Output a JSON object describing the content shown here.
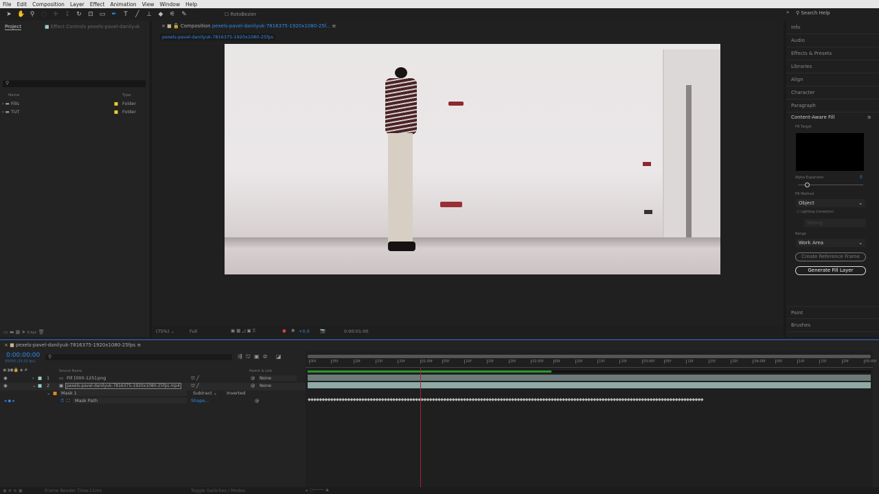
{
  "menu": [
    "File",
    "Edit",
    "Composition",
    "Layer",
    "Effect",
    "Animation",
    "View",
    "Window",
    "Help"
  ],
  "toolbar": {
    "rotobezier": "RotoBezier",
    "search_help": "Search Help"
  },
  "project": {
    "tab": "Project",
    "effect_controls_tab": "Effect Controls pexels-pavel-danilyuk",
    "columns": {
      "name": "Name",
      "type": "Type"
    },
    "items": [
      {
        "name": "Fills",
        "type": "Folder"
      },
      {
        "name": "TUT",
        "type": "Folder"
      }
    ],
    "bpc": "8 bpc"
  },
  "composition": {
    "tab_prefix": "Composition",
    "tab_name": "pexels-pavel-danilyuk-7816375-1920x1080-25f...",
    "subtab": "pexels-pavel-danilyuk-7816375-1920x1080-25fps",
    "zoom": "(75%)",
    "resolution": "Full",
    "exposure": "+0.0",
    "timecode": "0:00:01:00"
  },
  "right_panel": {
    "items": [
      "Info",
      "Audio",
      "Effects & Presets",
      "Libraries",
      "Align",
      "Character",
      "Paragraph"
    ],
    "caf": {
      "title": "Content-Aware Fill",
      "fill_target": "Fill Target",
      "alpha_expansion": "Alpha Expansion",
      "alpha_value": "5",
      "alpha_fraction": 0.1,
      "fill_method": "Fill Method",
      "fill_method_value": "Object",
      "lighting": "Lighting Correction",
      "lighting_value": "Strong",
      "range": "Range",
      "range_value": "Work Area",
      "create_ref": "Create Reference Frame",
      "generate": "Generate Fill Layer"
    },
    "bottom_items": [
      "Paint",
      "Brushes"
    ]
  },
  "timeline": {
    "tab": "pexels-pavel-danilyuk-7816375-1920x1080-25fps",
    "timecode": "0:00:00:00",
    "fps": "00000 (25.00 fps)",
    "columns": {
      "source": "Source Name",
      "parent": "Parent & Link"
    },
    "layers": [
      {
        "num": "1",
        "name": "Fill [000-125].png",
        "parent": "None"
      },
      {
        "num": "2",
        "name": "pexels-pavel-danilyuk-7816375-1920x1080-25fps.mp4",
        "parent": "None"
      }
    ],
    "mask": {
      "name": "Mask 1",
      "mode": "Subtract",
      "inverted": "Inverted",
      "path": "Mask Path",
      "path_value": "Shape..."
    },
    "ruler": [
      "00f",
      "05f",
      "10f",
      "15f",
      "20f",
      "01:00f",
      "05f",
      "10f",
      "15f",
      "20f",
      "02:00f",
      "05f",
      "10f",
      "15f",
      "20f",
      "03:00f",
      "05f",
      "10f",
      "15f",
      "20f",
      "04:00f",
      "05f",
      "10f",
      "15f",
      "20f",
      "05:00f"
    ],
    "playhead_seconds": 1.0,
    "duration_seconds": 5.0
  },
  "status": {
    "render_time": "Frame Render Time:",
    "render_value": "11ms",
    "toggle": "Toggle Switches / Modes"
  }
}
